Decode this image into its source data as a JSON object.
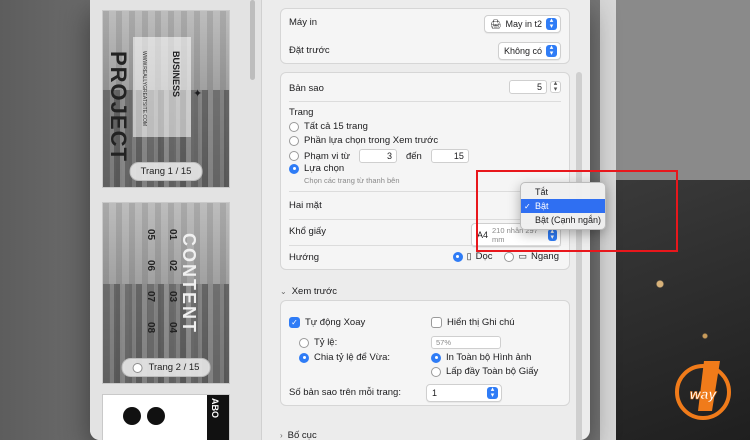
{
  "thumbnails": {
    "page1": {
      "label": "Trang 1 / 15",
      "title": "PROJECT",
      "subtitle": "BUSINESS",
      "url": "WWW.REALLYGREATSITE.COM"
    },
    "page2": {
      "label": "Trang 2 / 15",
      "title": "CONTENT",
      "numbers": [
        "01",
        "02",
        "03",
        "04",
        "05",
        "06",
        "07",
        "08"
      ]
    },
    "page3": {
      "title": "ABO"
    }
  },
  "printer": {
    "label": "Máy in",
    "value": "May in t2",
    "preset_label": "Đặt trước",
    "preset_value": "Không có"
  },
  "copies": {
    "label": "Bản sao",
    "value": "5"
  },
  "pages": {
    "label": "Trang",
    "all": "Tất cả 15 trang",
    "selection_preview": "Phần lựa chọn trong Xem trước",
    "range_label": "Phạm vi từ",
    "range_from": "3",
    "range_to_label": "đến",
    "range_to": "15",
    "choice": "Lựa chọn",
    "choice_hint": "Chọn các trang từ thanh bên"
  },
  "duplex": {
    "label": "Hai mặt"
  },
  "paper": {
    "label": "Khổ giấy",
    "value": "A4",
    "dims": "210 nhân 297 mm"
  },
  "orientation": {
    "label": "Hướng",
    "portrait": "Dọc",
    "landscape": "Ngang"
  },
  "duplex_menu": {
    "items": [
      "Tắt",
      "Bật",
      "Bật (Cạnh ngắn)"
    ],
    "selected_index": 1,
    "check_mark": "✓"
  },
  "preview": {
    "header": "Xem trước",
    "auto_rotate": "Tự động Xoay",
    "show_notes": "Hiển thị Ghi chú",
    "scale_label": "Tỷ lệ:",
    "scale_value": "57%",
    "fit_label": "Chia tỷ lệ để Vừa:",
    "print_entire": "In Toàn bộ Hình ảnh",
    "fill_paper": "Lấp đầy Toàn bộ Giấy",
    "copies_per_page_label": "Số bản sao trên mỗi trang:",
    "copies_per_page_value": "1"
  },
  "layout": {
    "header": "Bố cục"
  },
  "watermark": {
    "text": "way"
  },
  "colors": {
    "accent": "#2f7cf6",
    "highlight_box": "#e8171c",
    "logo_orange": "#f07b1a"
  }
}
